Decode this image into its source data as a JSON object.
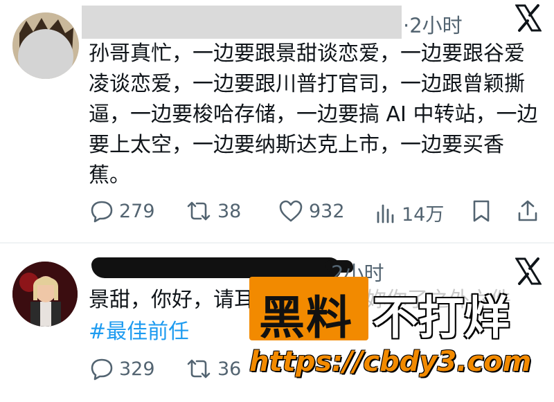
{
  "tweets": [
    {
      "time": "·2小时",
      "text": "孙哥真忙，一边要跟景甜谈恋爱，一边要跟谷爱凌谈恋爱，一边要跟川普打官司，一边跟曾颖撕逼，一边要梭哈存储，一边要搞 AI 中转站，一边要上太空，一边要纳斯达克上市，一边要买香蕉。",
      "replies": "279",
      "reposts": "38",
      "likes": "932",
      "views": "14万"
    },
    {
      "time": "2小时",
      "text": "景甜，你好，请耳",
      "text_tail": "妳你了之外六件",
      "hashtag": "#最佳前任",
      "replies": "329",
      "reposts": "36"
    }
  ],
  "watermark": {
    "main": "黑料",
    "side": "不打烊",
    "url": "https://cbdy3.com"
  },
  "colors": {
    "text": "#0f1419",
    "secondary": "#536471",
    "hashtag": "#1d9bf0",
    "watermark_orange": "#f28a00"
  },
  "icons": [
    "x-logo",
    "reply-icon",
    "repost-icon",
    "like-icon",
    "views-icon",
    "bookmark-icon",
    "share-icon"
  ]
}
